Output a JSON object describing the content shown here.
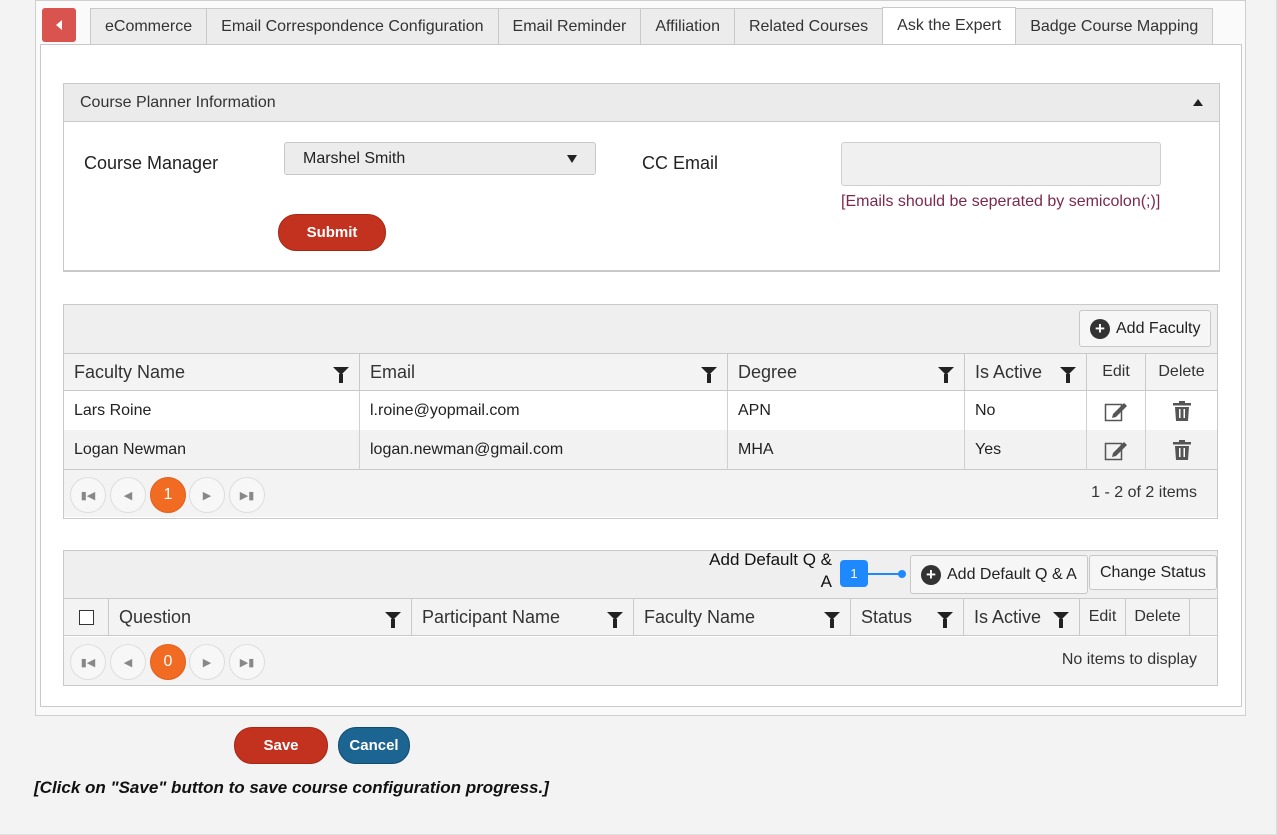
{
  "tabs": [
    {
      "label": "eCommerce"
    },
    {
      "label": "Email Correspondence Configuration"
    },
    {
      "label": "Email Reminder"
    },
    {
      "label": "Affiliation"
    },
    {
      "label": "Related Courses"
    },
    {
      "label": "Ask the Expert",
      "active": true
    },
    {
      "label": "Badge Course Mapping"
    }
  ],
  "planner": {
    "title": "Course Planner Information",
    "manager_label": "Course Manager",
    "manager_value": "Marshel Smith",
    "cc_label": "CC Email",
    "cc_value": "",
    "cc_hint": "[Emails should be seperated by semicolon(;)]",
    "submit_label": "Submit"
  },
  "faculty": {
    "add_label": "Add Faculty",
    "headers": [
      "Faculty Name",
      "Email",
      "Degree",
      "Is Active",
      "Edit",
      "Delete"
    ],
    "rows": [
      {
        "name": "Lars Roine",
        "email": "l.roine@yopmail.com",
        "degree": "APN",
        "active": "No"
      },
      {
        "name": "Logan Newman",
        "email": "logan.newman@gmail.com",
        "degree": "MHA",
        "active": "Yes"
      }
    ],
    "page": "1",
    "info": "1 - 2 of 2 items"
  },
  "qa": {
    "callout": "Add Default Q &",
    "callout_line2": "A",
    "badge": "1",
    "add_label": "Add Default Q & A",
    "status_label": "Change Status",
    "headers": [
      "Question",
      "Participant Name",
      "Faculty Name",
      "Status",
      "Is Active",
      "Edit",
      "Delete"
    ],
    "page": "0",
    "info": "No items to display"
  },
  "footer": {
    "save_label": "Save",
    "cancel_label": "Cancel",
    "note": "[Click on \"Save\" button to save course configuration progress.]"
  },
  "colors": {
    "accent_red": "#c3321f",
    "accent_blue": "#1c6491",
    "pager_orange": "#f26b22",
    "hint_purple": "#7b2a4d"
  }
}
